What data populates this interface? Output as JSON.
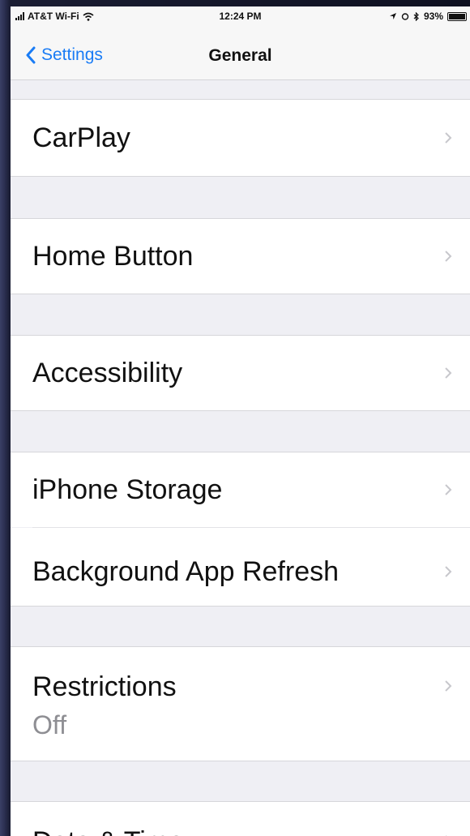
{
  "status_bar": {
    "carrier": "AT&T Wi-Fi",
    "time": "12:24 PM",
    "battery": "93%"
  },
  "nav": {
    "back_label": "Settings",
    "title": "General"
  },
  "rows": [
    {
      "label": "CarPlay"
    },
    {
      "label": "Home Button"
    },
    {
      "label": "Accessibility"
    },
    {
      "label": "iPhone Storage"
    },
    {
      "label": "Background App Refresh"
    },
    {
      "label": "Restrictions",
      "value": "Off"
    },
    {
      "label": "Date & Time"
    }
  ],
  "colors": {
    "tint": "#1a7cf5",
    "background": "#efeff4"
  }
}
